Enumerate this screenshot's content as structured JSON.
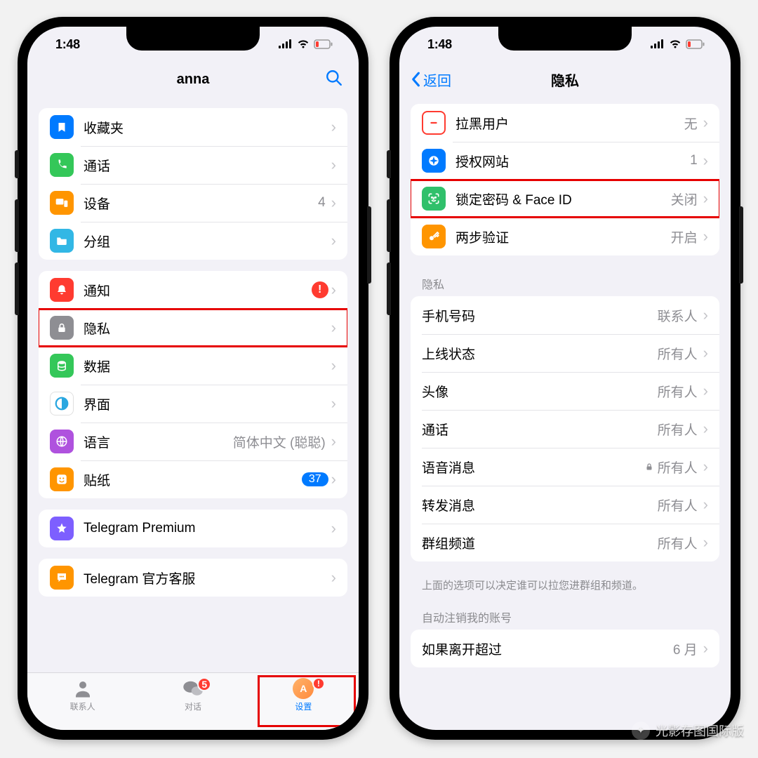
{
  "statusbar": {
    "time": "1:48"
  },
  "left": {
    "nav": {
      "title": "anna"
    },
    "groups": {
      "g1": [
        {
          "icon": "bookmark",
          "color": "#007aff",
          "label": "收藏夹"
        },
        {
          "icon": "phone",
          "color": "#34c759",
          "label": "通话"
        },
        {
          "icon": "devices",
          "color": "#ff9500",
          "label": "设备",
          "value": "4"
        },
        {
          "icon": "folder",
          "color": "#32b7e5",
          "label": "分组"
        }
      ],
      "g2": [
        {
          "icon": "bell",
          "color": "#ff3b30",
          "label": "通知",
          "alert": "!"
        },
        {
          "icon": "lock",
          "color": "#8e8e93",
          "label": "隐私"
        },
        {
          "icon": "data",
          "color": "#34c759",
          "label": "数据"
        },
        {
          "icon": "circle",
          "color": "#2aa7e0",
          "label": "界面"
        },
        {
          "icon": "globe",
          "color": "#af52de",
          "label": "语言",
          "value": "简体中文 (聪聪)"
        },
        {
          "icon": "sticker",
          "color": "#ff9500",
          "label": "贴纸",
          "badge": "37"
        }
      ],
      "g3": [
        {
          "icon": "star",
          "color": "#7d5fff",
          "label": "Telegram Premium"
        }
      ],
      "g4": [
        {
          "icon": "chat",
          "color": "#ff9500",
          "label": "Telegram 官方客服"
        }
      ]
    },
    "tabs": [
      {
        "key": "contacts",
        "label": "联系人"
      },
      {
        "key": "chats",
        "label": "对话",
        "badge": "5"
      },
      {
        "key": "settings",
        "label": "设置",
        "alert": "!"
      }
    ]
  },
  "right": {
    "nav": {
      "back": "返回",
      "title": "隐私"
    },
    "security": [
      {
        "icon": "minus",
        "color": "#ff3b30",
        "label": "拉黑用户",
        "value": "无"
      },
      {
        "icon": "compass",
        "color": "#007aff",
        "label": "授权网站",
        "value": "1"
      },
      {
        "icon": "faceid",
        "color": "#30c06b",
        "label": "锁定密码 & Face ID",
        "value": "关闭"
      },
      {
        "icon": "key",
        "color": "#ff9500",
        "label": "两步验证",
        "value": "开启"
      }
    ],
    "privacy_header": "隐私",
    "privacy": [
      {
        "label": "手机号码",
        "value": "联系人"
      },
      {
        "label": "上线状态",
        "value": "所有人"
      },
      {
        "label": "头像",
        "value": "所有人"
      },
      {
        "label": "通话",
        "value": "所有人"
      },
      {
        "label": "语音消息",
        "value": "所有人",
        "locked": true
      },
      {
        "label": "转发消息",
        "value": "所有人"
      },
      {
        "label": "群组频道",
        "value": "所有人"
      }
    ],
    "privacy_footer": "上面的选项可以决定谁可以拉您进群组和频道。",
    "delete_header": "自动注销我的账号",
    "delete_row": {
      "label": "如果离开超过",
      "value": "6 月"
    }
  },
  "watermark": "光影存图国际版"
}
